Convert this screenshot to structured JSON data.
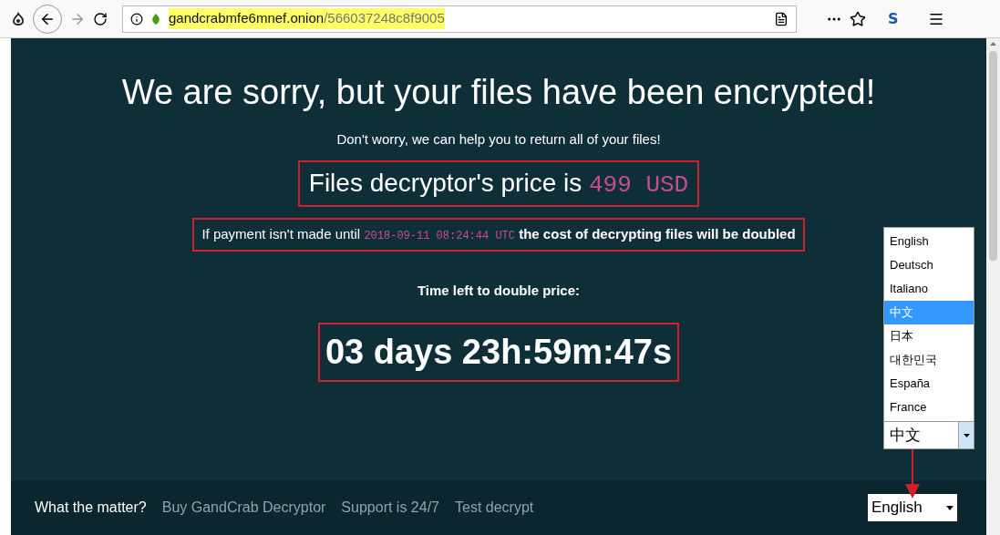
{
  "browser": {
    "url_host": "gandcrabmfe6mnef.onion",
    "url_path": "/566037248c8f9005",
    "profile_badge": "S"
  },
  "page": {
    "title": "We are sorry, but your files have been encrypted!",
    "subtitle": "Don't worry, we can help you to return all of your files!",
    "price_label": "Files decryptor's price is",
    "price_value": "499 USD",
    "deadline_prefix": "If payment isn't made until",
    "deadline_date": "2018-09-11 08:24:44 UTC",
    "deadline_suffix": "the cost of decrypting files will be doubled",
    "countdown_label": "Time left to double price:",
    "countdown": "03 days 23h:59m:47s"
  },
  "language_dropdown": {
    "value": "中文",
    "options": [
      {
        "label": "English",
        "selected": false
      },
      {
        "label": "Deutsch",
        "selected": false
      },
      {
        "label": "Italiano",
        "selected": false
      },
      {
        "label": "中文",
        "selected": true
      },
      {
        "label": "日本",
        "selected": false
      },
      {
        "label": "대한민국",
        "selected": false
      },
      {
        "label": "España",
        "selected": false
      },
      {
        "label": "France",
        "selected": false
      }
    ]
  },
  "footer": {
    "nav": [
      {
        "label": "What the matter?",
        "selected": true
      },
      {
        "label": "Buy GandCrab Decryptor",
        "selected": false
      },
      {
        "label": "Support is 24/7",
        "selected": false
      },
      {
        "label": "Test decrypt",
        "selected": false
      }
    ],
    "language": "English"
  }
}
